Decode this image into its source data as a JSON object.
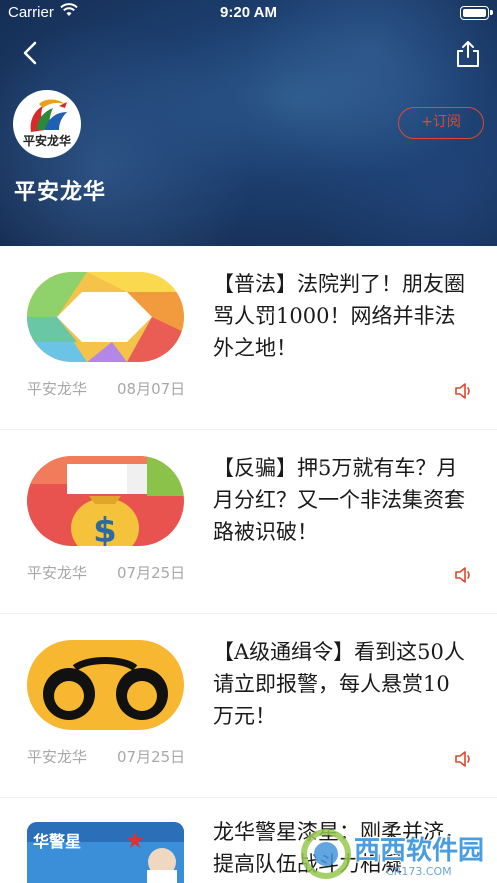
{
  "status_bar": {
    "carrier": "Carrier",
    "time": "9:20 AM"
  },
  "channel": {
    "logo_text": "平安龙华",
    "title": "平安龙华",
    "subscribe_label": "+订阅"
  },
  "articles": [
    {
      "title": "【普法】法院判了！朋友圈骂人罚1000！网络并非法外之地！",
      "source": "平安龙华",
      "date": "08月07日"
    },
    {
      "title": "【反骗】押5万就有车？月月分红？又一个非法集资套路被识破！",
      "source": "平安龙华",
      "date": "07月25日"
    },
    {
      "title": "【A级通缉令】看到这50人请立即报警，每人悬赏10万元！",
      "source": "平安龙华",
      "date": "07月25日"
    },
    {
      "title": "龙华警星漆星：刚柔并济，提高队伍战斗力相凝",
      "thumb_text": "华警星"
    }
  ],
  "watermark": {
    "text": "西西软件园",
    "sub": "CR173.COM"
  },
  "colors": {
    "accent": "#e0492a",
    "header_bg": "#1c3e6e"
  }
}
